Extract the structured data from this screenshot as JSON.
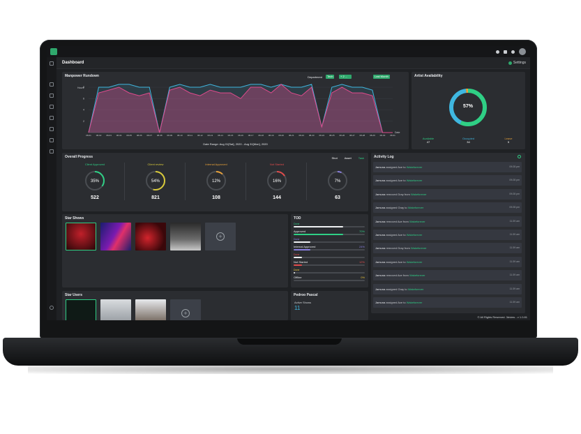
{
  "header": {
    "title": "Dashboard",
    "settings_label": "Settings"
  },
  "manpower": {
    "title": "Manpower Rundown",
    "department_label": "Department",
    "filter_chips": [
      "Tech",
      "+ 2 ..."
    ],
    "range_button": "Last Month",
    "y_label": "Hours",
    "x_end_label": "Date",
    "date_range": "Date Range: Aug 01[Sat], 2020 - Aug 31[Mon], 2020",
    "y_ticks": [
      "8",
      "6",
      "4",
      "2"
    ],
    "x_ticks": [
      "08-01",
      "08-02",
      "08-03",
      "08-04",
      "08-05",
      "08-06",
      "08-07",
      "08-08",
      "08-09",
      "08-10",
      "08-11",
      "08-12",
      "08-13",
      "08-14",
      "08-15",
      "08-16",
      "08-17",
      "08-18",
      "08-19",
      "08-20",
      "08-21",
      "08-22",
      "08-23",
      "08-24",
      "08-25",
      "08-26",
      "08-27",
      "08-28",
      "08-29",
      "08-30",
      "08-31"
    ]
  },
  "chart_data": {
    "type": "area",
    "x": [
      "08-01",
      "08-02",
      "08-03",
      "08-04",
      "08-05",
      "08-06",
      "08-07",
      "08-08",
      "08-09",
      "08-10",
      "08-11",
      "08-12",
      "08-13",
      "08-14",
      "08-15",
      "08-16",
      "08-17",
      "08-18",
      "08-19",
      "08-20",
      "08-21",
      "08-22",
      "08-23",
      "08-24",
      "08-25",
      "08-26",
      "08-27",
      "08-28",
      "08-29",
      "08-30",
      "08-31"
    ],
    "ylim": [
      0,
      8
    ],
    "series": [
      {
        "values": [
          0,
          8,
          8,
          8.5,
          8.5,
          8,
          8,
          0,
          8,
          8.5,
          8,
          8,
          8.5,
          8,
          8,
          8,
          8.5,
          8.5,
          8,
          8.5,
          8,
          8,
          8.5,
          1,
          8,
          8.5,
          8,
          8,
          7.5,
          0,
          0
        ],
        "color": "#3fb7e0"
      },
      {
        "values": [
          0,
          7,
          7.5,
          8,
          7,
          6.5,
          7,
          0,
          7.5,
          8,
          7,
          6.5,
          7.5,
          7,
          7,
          6,
          8,
          8,
          7,
          8.5,
          7,
          6.5,
          8,
          1,
          7,
          8,
          7,
          7,
          6.5,
          0,
          0
        ],
        "color": "#e04b8c"
      }
    ]
  },
  "artist_availability": {
    "title": "Artist Availability",
    "center_value": "57%",
    "stats": [
      {
        "label": "Available",
        "value": "47",
        "color": "#2fcf85"
      },
      {
        "label": "Occupied",
        "value": "34",
        "color": "#3fb7e0"
      },
      {
        "label": "Leave",
        "value": "5",
        "color": "#e8a23a"
      }
    ],
    "fractions": [
      0.57,
      0.41,
      0.02
    ]
  },
  "overall_progress": {
    "title": "Overall Progress",
    "tabs": [
      "Shot",
      "Asset",
      "Task"
    ],
    "items": [
      {
        "label": "Client Approved",
        "percent": "35%",
        "count": "522",
        "fraction": 0.35,
        "color": "#2fcf85"
      },
      {
        "label": "Client review",
        "percent": "54%",
        "count": "821",
        "fraction": 0.54,
        "color": "#d8c93a"
      },
      {
        "label": "Internal Approved",
        "percent": "12%",
        "count": "108",
        "fraction": 0.12,
        "color": "#e8a23a"
      },
      {
        "label": "Not Started",
        "percent": "16%",
        "count": "144",
        "fraction": 0.16,
        "color": "#e04b4b"
      },
      {
        "label": "",
        "percent": "7%",
        "count": "63",
        "fraction": 0.07,
        "color": "#8a7fe0"
      }
    ]
  },
  "star_shows": {
    "title": "Star Shows"
  },
  "star_users": {
    "title": "Star Users"
  },
  "todo": {
    "title": "TOD",
    "items": [
      {
        "sub": "Done",
        "label": "Approved",
        "percent": "70%",
        "fraction": 0.7,
        "color": "#2fcf85"
      },
      {
        "sub": "Done",
        "label": "Internal Approved",
        "percent": "24%",
        "fraction": 0.24,
        "color": "#8a7fe0"
      },
      {
        "sub": "Done",
        "label": "Not Started",
        "percent": "12%",
        "fraction": 0.12,
        "color": "#e04b4b"
      },
      {
        "sub": "Done",
        "label": "Offline",
        "percent": "0%",
        "fraction": 0.0,
        "color": "#e8c23a"
      }
    ]
  },
  "person": {
    "name": "Pedroo Pascal",
    "active_label": "Active Shows",
    "active_value": "11"
  },
  "activity_log": {
    "title": "Activity Log",
    "entries": [
      {
        "actor": "Jamuna",
        "action": "assigned",
        "item": "Ace",
        "prep": "to",
        "target": "Wakeforever",
        "time": "09:28 pm"
      },
      {
        "actor": "Jamuna",
        "action": "assigned",
        "item": "Ace",
        "prep": "to",
        "target": "Wakeforever",
        "time": "09:28 pm"
      },
      {
        "actor": "Jamuna",
        "action": "removed",
        "item": "Gray",
        "prep": "from",
        "target": "Wakeforever",
        "time": "09:28 pm"
      },
      {
        "actor": "Jamuna",
        "action": "assigned",
        "item": "Gray",
        "prep": "to",
        "target": "Wakeforever",
        "time": "09:28 pm"
      },
      {
        "actor": "Jamuna",
        "action": "removed",
        "item": "Ace",
        "prep": "from",
        "target": "Wakeforever",
        "time": "11:39 am"
      },
      {
        "actor": "Jamuna",
        "action": "assigned",
        "item": "Ace",
        "prep": "to",
        "target": "Wakeforever",
        "time": "11:39 am"
      },
      {
        "actor": "Jamuna",
        "action": "removed",
        "item": "Gray",
        "prep": "from",
        "target": "Wakeforever",
        "time": "11:39 am"
      },
      {
        "actor": "Jamuna",
        "action": "assigned",
        "item": "Ace",
        "prep": "to",
        "target": "Wakeforever",
        "time": "11:39 am"
      },
      {
        "actor": "Jamuna",
        "action": "removed",
        "item": "Ace",
        "prep": "from",
        "target": "Wakeforever",
        "time": "11:39 am"
      },
      {
        "actor": "Jamuna",
        "action": "assigned",
        "item": "Gray",
        "prep": "to",
        "target": "Wakeforever",
        "time": "11:39 am"
      },
      {
        "actor": "Jamuna",
        "action": "assigned",
        "item": "Ace",
        "prep": "to",
        "target": "Wakeforever",
        "time": "11:39 am"
      }
    ]
  },
  "footer": {
    "text": "© All Rights Reserved. 3dview - v 1.0.81"
  }
}
